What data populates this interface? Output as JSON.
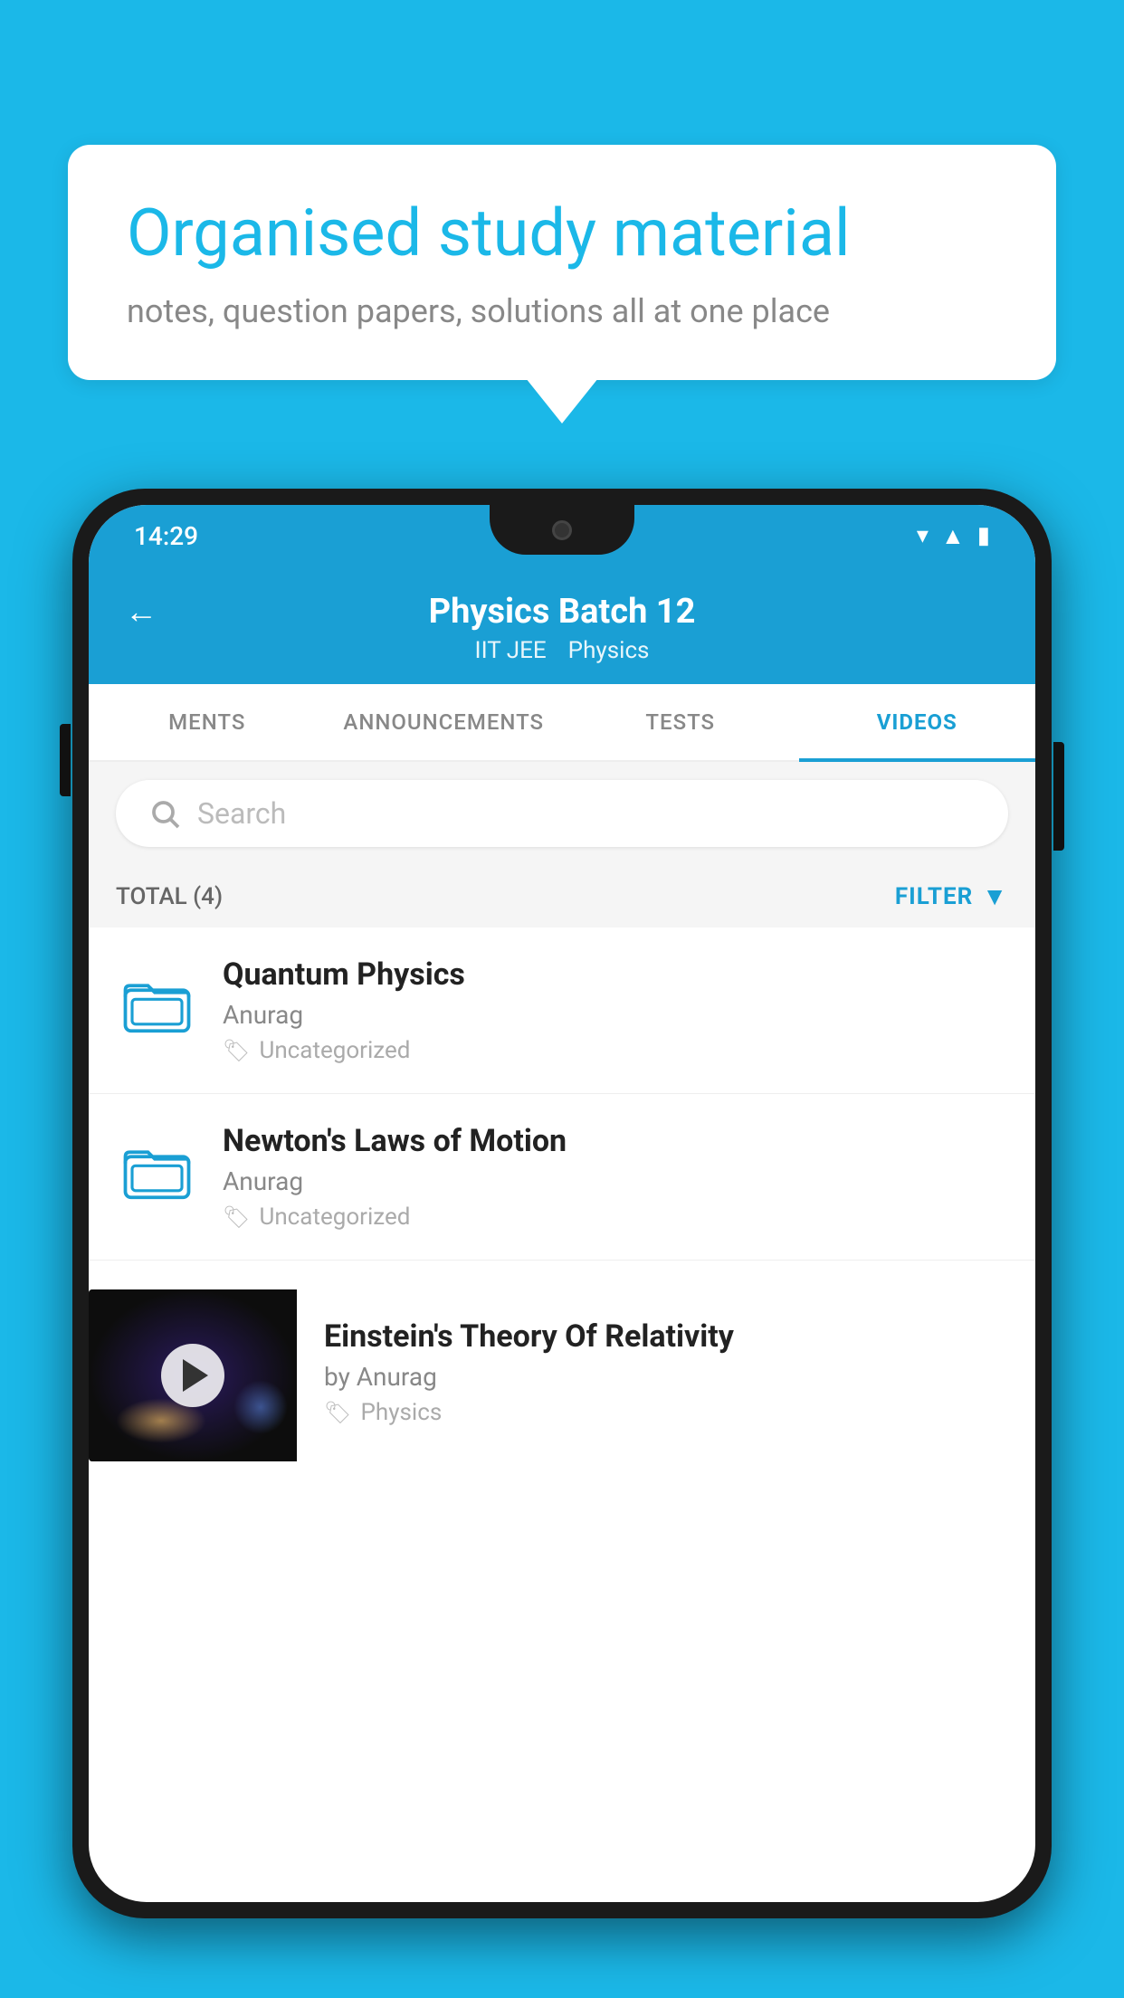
{
  "background_color": "#1BB8E8",
  "speech_bubble": {
    "title": "Organised study material",
    "subtitle": "notes, question papers, solutions all at one place"
  },
  "phone": {
    "status_bar": {
      "time": "14:29",
      "icons": [
        "wifi",
        "signal",
        "battery"
      ]
    },
    "header": {
      "title": "Physics Batch 12",
      "tags": [
        "IIT JEE",
        "Physics"
      ],
      "back_label": "←"
    },
    "tabs": [
      {
        "label": "MENTS",
        "active": false
      },
      {
        "label": "ANNOUNCEMENTS",
        "active": false
      },
      {
        "label": "TESTS",
        "active": false
      },
      {
        "label": "VIDEOS",
        "active": true
      }
    ],
    "search": {
      "placeholder": "Search"
    },
    "filter_bar": {
      "total_label": "TOTAL (4)",
      "filter_label": "FILTER"
    },
    "videos": [
      {
        "title": "Quantum Physics",
        "author": "Anurag",
        "tag": "Uncategorized",
        "has_thumbnail": false
      },
      {
        "title": "Newton's Laws of Motion",
        "author": "Anurag",
        "tag": "Uncategorized",
        "has_thumbnail": false
      },
      {
        "title": "Einstein's Theory Of Relativity",
        "author": "by Anurag",
        "tag": "Physics",
        "has_thumbnail": true
      }
    ]
  }
}
